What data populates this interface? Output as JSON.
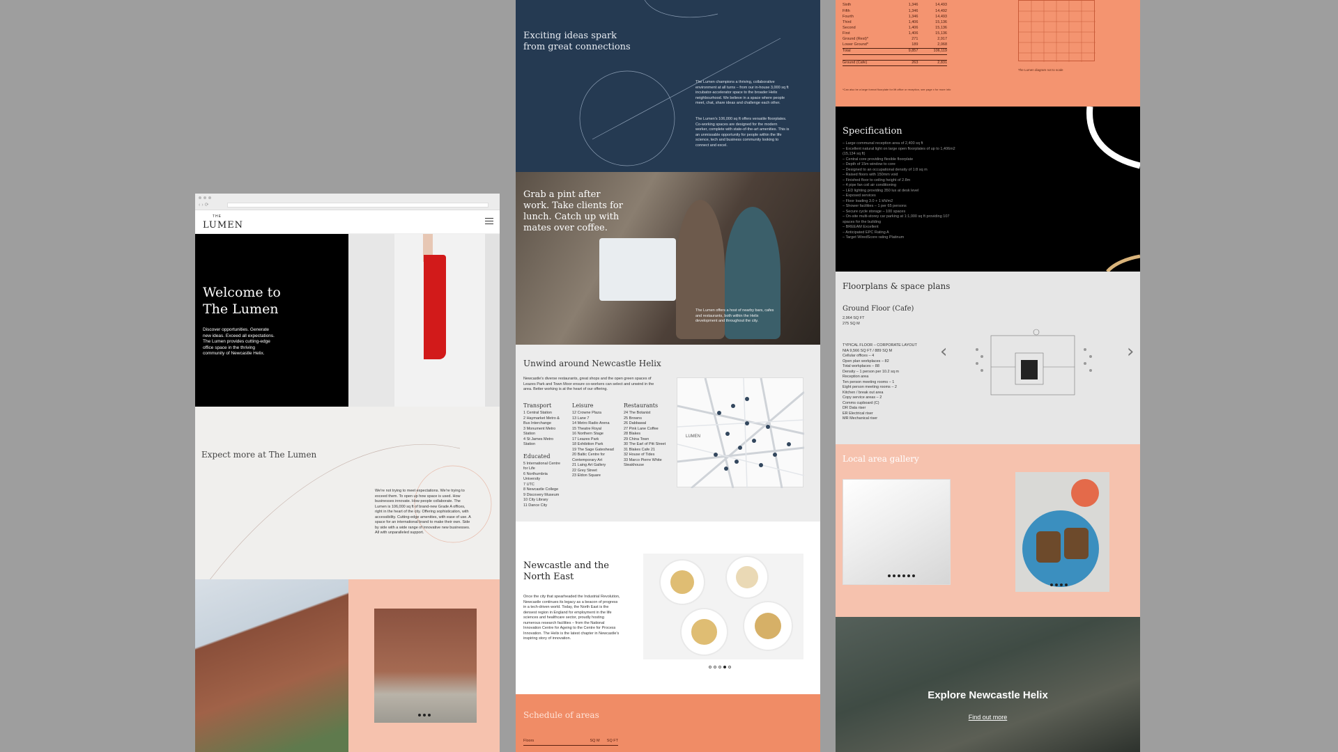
{
  "colors": {
    "background": "#9e9e9e",
    "navy": "#253a52",
    "salmon": "#f08c66",
    "peach": "#f6c2ae",
    "black": "#000000"
  },
  "desktop": {
    "logo": {
      "the": "THE",
      "lumen": "LUMEN"
    },
    "hero": {
      "title_line1": "Welcome to",
      "title_line2": "The Lumen",
      "body": "Discover opportunities. Generate new ideas. Exceed all expectations. The Lumen provides cutting-edge office space in the thriving community of Newcastle Helix."
    },
    "expect": {
      "title": "Expect more at The Lumen",
      "body": "We're not trying to meet expectations. We're trying to exceed them. To open up how space is used. How businesses innovate. How people collaborate. The Lumen is 106,000 sq ft of brand-new Grade A offices, right in the heart of the city. Offering sophistication, with accessibility. Cutting-edge amenities, with ease of use. A space for an international brand to make their own. Side by side with a wide range of innovative new businesses. All with unparalleled support."
    }
  },
  "page2": {
    "connections": {
      "title": "Exciting ideas spark from great connections",
      "p1": "The Lumen champions a thriving, collaborative environment at all turns – from our in-house 3,000 sq ft incubator-accelerator space to the broader Helix neighbourhood. We believe in a space where people meet, chat, share ideas and challenge each other.",
      "p2": "The Lumen's 106,000 sq ft offers versatile floorplates. Co-working spaces are designed for the modern worker, complete with state-of-the-art amenities. This is an unmissable opportunity for people within the life science, tech and business community looking to connect and excel."
    },
    "pub": {
      "title": "Grab a pint after work. Take clients for lunch. Catch up with mates over coffee.",
      "caption": "The Lumen offers a host of nearby bars, cafes and restaurants, both within the Helix development and throughout the city."
    },
    "unwind": {
      "title": "Unwind around Newcastle Helix",
      "intro": "Newcastle's diverse restaurants, great shops and the open green spaces of Leazes Park and Town Moor ensure co-workers can select and unwind in the area. Better working is at the heart of our offering.",
      "transport_h": "Transport",
      "transport": [
        "1  Central Station",
        "2  Haymarket Metro & Bus Interchange",
        "3  Monument Metro Station",
        "4  St James Metro Station"
      ],
      "educated_h": "Educated",
      "educated": [
        "5  International Centre for Life",
        "6  Northumbria University",
        "7  UTC",
        "8  Newcastle College",
        "9  Discovery Museum",
        "10  City Library",
        "11  Dance City"
      ],
      "leisure_h": "Leisure",
      "leisure": [
        "12  Crowne Plaza",
        "13  Lane 7",
        "14  Metro Radio Arena",
        "15  Theatre Royal",
        "16  Northern Stage",
        "17  Leazes Park",
        "18  Exhibition Park",
        "19  The Sage Gateshead",
        "20  Baltic Centre for Contemporary Art",
        "21  Laing Art Gallery",
        "22  Grey Street",
        "23  Eldon Square"
      ],
      "restaurants_h": "Restaurants",
      "restaurants": [
        "24  The Botanist",
        "25  Browns",
        "26  Dabbawal",
        "27  Pink Lane Coffee",
        "28  Blakes",
        "29  China Town",
        "30  The Earl of Pitt Street",
        "31  Blakes Cafe 21",
        "32  House of Tides",
        "33  Marco Pierre White Steakhouse"
      ],
      "map_label": "LUMEN"
    },
    "newcastle": {
      "title": "Newcastle and the North East",
      "body": "Once the city that spearheaded the Industrial Revolution, Newcastle continues its legacy as a beacon of progress in a tech-driven world. Today, the North East is the densest region in England for employment in the life sciences and healthcare sector, proudly hosting numerous research facilities – from the National Innovation Centre for Ageing to the Centre for Process Innovation. The Helix is the latest chapter in Newcastle's inspiring story of innovation."
    },
    "schedule": {
      "title": "Schedule of areas",
      "floors": "Floors",
      "sqm": "SQ M",
      "sqft": "SQ FT"
    }
  },
  "page3": {
    "areas": {
      "rows": [
        [
          "Sixth",
          "1,346",
          "14,493"
        ],
        [
          "Fifth",
          "1,346",
          "14,492"
        ],
        [
          "Fourth",
          "1,346",
          "14,493"
        ],
        [
          "Third",
          "1,406",
          "15,136"
        ],
        [
          "Second",
          "1,406",
          "15,136"
        ],
        [
          "First",
          "1,406",
          "15,136"
        ],
        [
          "Ground (Rest)*",
          "271",
          "2,917"
        ],
        [
          "Lower Ground*",
          "189",
          "2,068"
        ]
      ],
      "total": [
        "Total",
        "9,857",
        "106,119"
      ],
      "cafe": [
        "Ground (Cafe)",
        "263",
        "2,831"
      ],
      "note": "*Can also be a large format floorplate for lift office or reception, see page x for more info",
      "elev_caption": "The Lumen diagram not to scale"
    },
    "spec": {
      "title": "Specification",
      "items": [
        "– Large communal reception area of 2,400 sq ft",
        "– Excellent natural light on large open floorplates of up to 1,406m2 (15,134 sq ft)",
        "– Central core providing flexible floorplate",
        "– Depth of 15m window to core",
        "– Designed to an occupational density of 1:8 sq m",
        "– Raised floors with 150mm void",
        "– Finished floor to ceiling height of 2.8m",
        "– 4 pipe fan coil air conditioning",
        "– LED lighting providing 350 lux at desk level",
        "– Exposed services",
        "– Floor loading 3.0 + 1 kN/m2",
        "– Shower facilities – 1 per 65 persons",
        "– Secure cycle storage – 100 spaces",
        "– On-site multi-storey car parking at 1:1,000 sq ft providing 107 spaces for the building",
        "– BREEAM Excellent",
        "– Anticipated EPC Rating A",
        "– Target WiredScore rating Platinum"
      ]
    },
    "floor": {
      "title": "Floorplans & space plans",
      "subtitle": "Ground Floor (Cafe)",
      "sqft": "2,964 SQ FT",
      "sqm": "275 SQ M",
      "layout_title": "TYPICAL FLOOR – CORPORATE LAYOUT",
      "layout": [
        "NIA 9,566 SQ FT / 889 SQ M",
        "",
        "Cellular offices – 4",
        "Open plan workplaces – 82",
        "Total workplaces – 88",
        "Density – 1 person per 10.2 sq m",
        "Reception area",
        "Ten person meeting rooms – 1",
        "Eight person meeting rooms – 2",
        "Kitchen / break out area",
        "Copy service areas – 2",
        "Comms cupboard (C)",
        "DR Data riser",
        "ER Electrical riser",
        "MR Mechanical riser"
      ],
      "prev": "‹",
      "next": "›"
    },
    "gallery": {
      "title": "Local area gallery"
    },
    "explore": {
      "title": "Explore Newcastle Helix",
      "link": "Find out more"
    }
  }
}
